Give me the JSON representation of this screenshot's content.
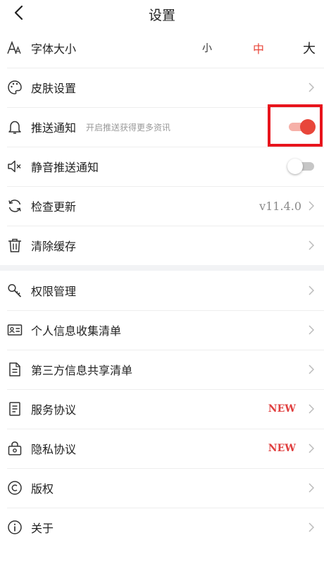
{
  "header": {
    "title": "设置"
  },
  "section1": [
    {
      "id": "font",
      "label": "字体大小",
      "icon": "font-size-icon",
      "sizes": {
        "small": "小",
        "medium": "中",
        "large": "大",
        "selected": "中"
      }
    },
    {
      "id": "skin",
      "label": "皮肤设置",
      "icon": "palette-icon"
    },
    {
      "id": "push",
      "label": "推送通知",
      "hint": "开启推送获得更多资讯",
      "icon": "bell-icon",
      "toggle": "on"
    },
    {
      "id": "silent",
      "label": "静音推送通知",
      "icon": "mute-icon",
      "toggle": "off"
    },
    {
      "id": "update",
      "label": "检查更新",
      "icon": "refresh-icon",
      "version": "v11.4.0"
    },
    {
      "id": "cache",
      "label": "清除缓存",
      "icon": "trash-icon"
    }
  ],
  "section2": [
    {
      "id": "perm",
      "label": "权限管理",
      "icon": "key-icon"
    },
    {
      "id": "personal",
      "label": "个人信息收集清单",
      "icon": "id-card-icon"
    },
    {
      "id": "thirdparty",
      "label": "第三方信息共享清单",
      "icon": "document-icon"
    },
    {
      "id": "service",
      "label": "服务协议",
      "icon": "agreement-icon",
      "badge": "NEW"
    },
    {
      "id": "privacy",
      "label": "隐私协议",
      "icon": "privacy-lock-icon",
      "badge": "NEW"
    },
    {
      "id": "copyright",
      "label": "版权",
      "icon": "copyright-icon"
    },
    {
      "id": "about",
      "label": "关于",
      "icon": "info-icon"
    }
  ],
  "colors": {
    "accent": "#e8463a",
    "badge": "#e04040",
    "highlight": "#e8141c"
  }
}
